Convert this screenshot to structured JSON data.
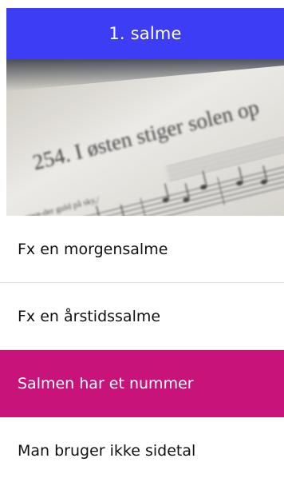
{
  "header": {
    "title": "1. salme",
    "color": "#3d3df5"
  },
  "photo": {
    "heading_text": "254. I østen stiger solen op",
    "lyrics_text": "sprø-der guld på sky,/",
    "description": "sheet-music-photo"
  },
  "options": [
    {
      "label": "Fx en morgensalme",
      "selected": false
    },
    {
      "label": "Fx en årstidssalme",
      "selected": false
    },
    {
      "label": "Salmen har et nummer",
      "selected": true
    },
    {
      "label": "Man bruger ikke sidetal",
      "selected": false
    }
  ],
  "colors": {
    "selected": "#c8147a",
    "header": "#3d3df5"
  }
}
